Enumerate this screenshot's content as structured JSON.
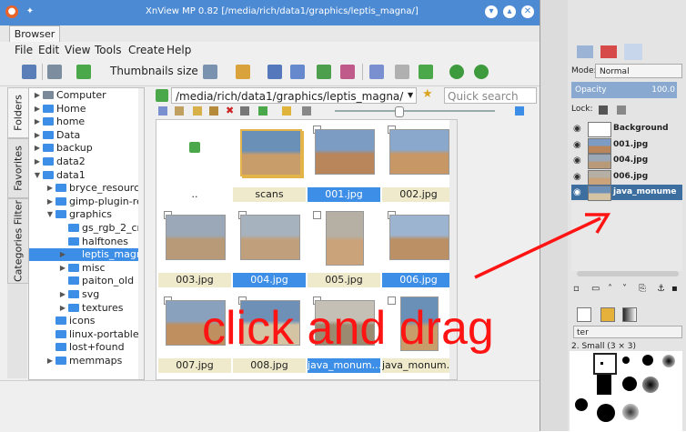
{
  "window": {
    "title": "XnView MP 0.82 [/media/rich/data1/graphics/leptis_magna/]"
  },
  "tabs": [
    {
      "label": "Browser"
    }
  ],
  "menu": [
    {
      "label": "File"
    },
    {
      "label": "Edit"
    },
    {
      "label": "View"
    },
    {
      "label": "Tools"
    },
    {
      "label": "Create"
    },
    {
      "label": "Help"
    }
  ],
  "toolbar": {
    "thumbnails_label": "Thumbnails size"
  },
  "side_tabs": [
    {
      "label": "Folders"
    },
    {
      "label": "Favorites"
    },
    {
      "label": "Categories Filter"
    }
  ],
  "tree": [
    {
      "label": "Computer",
      "indent": 0
    },
    {
      "label": "Home",
      "indent": 0
    },
    {
      "label": "home",
      "indent": 0
    },
    {
      "label": "Data",
      "indent": 0
    },
    {
      "label": "backup",
      "indent": 0
    },
    {
      "label": "data2",
      "indent": 0
    },
    {
      "label": "data1",
      "indent": 0
    },
    {
      "label": "bryce_resource",
      "indent": 1
    },
    {
      "label": "gimp-plugin-reg",
      "indent": 1
    },
    {
      "label": "graphics",
      "indent": 1
    },
    {
      "label": "gs_rgb_2_cmy",
      "indent": 2
    },
    {
      "label": "halftones",
      "indent": 2
    },
    {
      "label": "leptis_magna",
      "indent": 2,
      "selected": true
    },
    {
      "label": "misc",
      "indent": 2
    },
    {
      "label": "paiton_old",
      "indent": 2
    },
    {
      "label": "svg",
      "indent": 2
    },
    {
      "label": "textures",
      "indent": 2
    },
    {
      "label": "icons",
      "indent": 1
    },
    {
      "label": "linux-portable-n",
      "indent": 1
    },
    {
      "label": "lost+found",
      "indent": 1
    },
    {
      "label": "memmaps",
      "indent": 1
    }
  ],
  "path": {
    "value": "/media/rich/data1/graphics/leptis_magna/"
  },
  "search": {
    "placeholder": "Quick search"
  },
  "thumbnails": [
    {
      "label": "..",
      "kind": "up"
    },
    {
      "label": "scans",
      "kind": "folder"
    },
    {
      "label": "001.jpg",
      "selected": true
    },
    {
      "label": "002.jpg"
    },
    {
      "label": "003.jpg"
    },
    {
      "label": "004.jpg",
      "selected": true
    },
    {
      "label": "005.jpg"
    },
    {
      "label": "006.jpg",
      "selected": true
    },
    {
      "label": "007.jpg"
    },
    {
      "label": "008.jpg"
    },
    {
      "label": "java_monum...",
      "selected": true
    },
    {
      "label": "java_monum..."
    }
  ],
  "gimp": {
    "mode_label": "Mode:",
    "mode_value": "Normal",
    "opacity_label": "Opacity",
    "opacity_value": "100.0",
    "lock_label": "Lock:",
    "layers": [
      {
        "name": "Background"
      },
      {
        "name": "001.jpg"
      },
      {
        "name": "004.jpg"
      },
      {
        "name": "006.jpg"
      },
      {
        "name": "java_monume",
        "selected": true
      }
    ],
    "filter_label": "ter",
    "brush_label": "2. Small (3 × 3)"
  },
  "overlay": {
    "text": "click and drag"
  },
  "colors": {
    "accent": "#3d8ee6",
    "titlebar": "#4c8ad3",
    "annotation": "#ff1414"
  }
}
